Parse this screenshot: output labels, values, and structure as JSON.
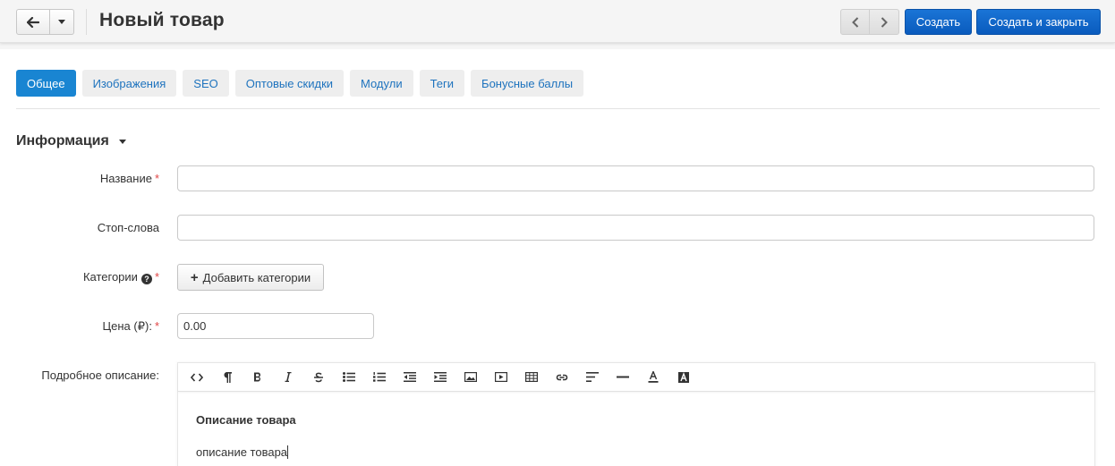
{
  "header": {
    "title": "Новый товар",
    "create_label": "Создать",
    "create_close_label": "Создать и закрыть"
  },
  "tabs": [
    {
      "label": "Общее",
      "active": true
    },
    {
      "label": "Изображения",
      "active": false
    },
    {
      "label": "SEO",
      "active": false
    },
    {
      "label": "Оптовые скидки",
      "active": false
    },
    {
      "label": "Модули",
      "active": false
    },
    {
      "label": "Теги",
      "active": false
    },
    {
      "label": "Бонусные баллы",
      "active": false
    }
  ],
  "section": {
    "title": "Информация"
  },
  "form": {
    "name_label": "Название",
    "stopwords_label": "Стоп-слова",
    "categories_label": "Категории",
    "add_categories_label": "Добавить категории",
    "price_label": "Цена (₽):",
    "price_value": "0.00",
    "description_label": "Подробное описание:",
    "required_mark": "*"
  },
  "editor": {
    "toolbar": [
      "html-icon",
      "paragraph-icon",
      "bold-icon",
      "italic-icon",
      "strikethrough-icon",
      "unordered-list-icon",
      "ordered-list-icon",
      "outdent-icon",
      "indent-icon",
      "image-icon",
      "video-icon",
      "table-icon",
      "link-icon",
      "align-left-icon",
      "horizontal-rule-icon",
      "font-color-icon",
      "background-color-icon"
    ],
    "heading": "Описание товара",
    "text": "описание товара"
  },
  "colors": {
    "primary": "#1985d2",
    "button_primary": "#0a5bbd",
    "required": "#e04646",
    "tab_link": "#1e73be"
  }
}
